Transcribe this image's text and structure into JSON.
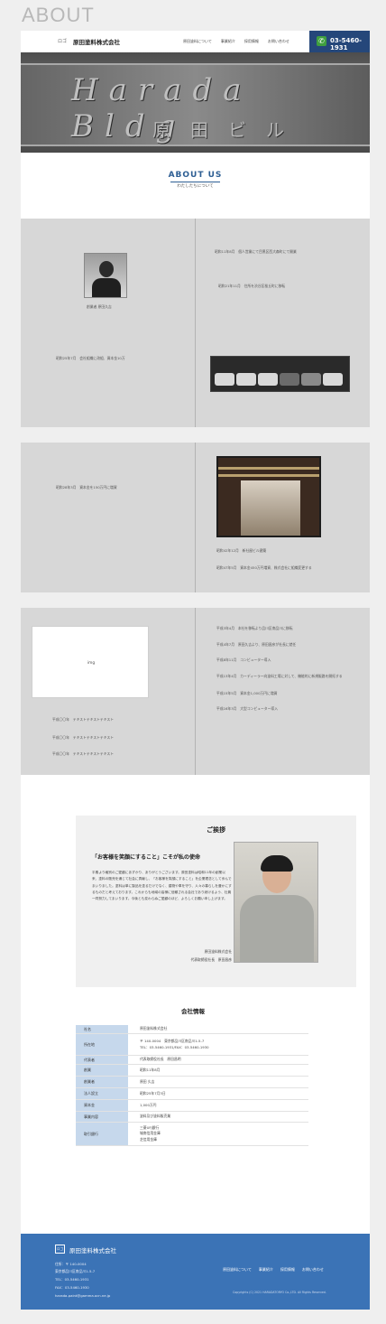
{
  "page_heading": "ABOUT",
  "header": {
    "logo": "ロゴ",
    "company": "原田塗料株式会社",
    "nav": [
      "原田塗料について",
      "事業紹介",
      "採用情報",
      "お問い合わせ"
    ],
    "phone": "03-5460-1931"
  },
  "about": {
    "title": "ABOUT US",
    "subtitle": "わたしたちについて"
  },
  "history": {
    "founder_caption": "創業者 原田久吉",
    "e1": "昭和11年8月　個人営業にて目黒区西大森町にて開業",
    "e2": "昭和21年11月　住所を渋谷区桜丘町に移転",
    "e3": "昭和25年7月　会社組織に改組、資本金10万",
    "e4": "昭和28年3月　資本金を150万円に増資",
    "e5": "昭和42年12月　新社屋ビル建築",
    "e6": "昭和47年5月　資本金450万円増資、株式会社に組織変更する",
    "e7": "平成3年4月　本社を移転より品川区南品川に移転",
    "e8": "平成4年7月　原田久吉より、原田昌彦が社長に就任",
    "e9": "平成8年11月　コンピューター導入",
    "e10": "平成13年4月　カーディーラー向塗料工場に対して、機能的に新規販路を開拓する",
    "e11": "平成15年5月　資本金1,000万円に増資",
    "e12": "平成16年3月　大型コンピューター導入",
    "img_label": "img",
    "p1": "平成〇〇年　テキストテキストテキスト",
    "p2": "平成〇〇年　テキストテキストテキスト",
    "p3": "平成〇〇年　テキストテキストテキスト"
  },
  "greeting": {
    "title": "ご挨拶",
    "mission": "「お客様を笑顔にすること」こそが私の使命",
    "body": "平素より格別のご愛顧にあずかり、ありがとうございます。原田塗料は昭和11年の創業以来、塗料の販売を通じて社会に貢献し、「お客様を笑顔にすること」を企業理念として歩んでまいりました。塗料は単に製品を塗るだけでなく、建物や車を守り、人々の暮らしを豊かにするものだと考えております。これからも地域の皆様に信頼される会社であり続けるよう、社員一同努力してまいります。今後とも変わらぬご愛顧のほど、よろしくお願い申し上げます。",
    "sign_company": "原田塗料株式会社",
    "sign_name": "代表取締役社長　原田昌彦"
  },
  "company_info": {
    "title": "会社情報",
    "rows": [
      {
        "label": "社名",
        "lines": [
          "原田塗料株式会社"
        ]
      },
      {
        "label": "所在地",
        "lines": [
          "〒 140-0004　東京都品川区南品川1-5-7",
          "TEL：03-5460-1931/FAX：03-5460-1930"
        ]
      },
      {
        "label": "代表者",
        "lines": [
          "代表取締役社長　原田昌明"
        ]
      },
      {
        "label": "創業",
        "lines": [
          "昭和11年8月"
        ]
      },
      {
        "label": "創業者",
        "lines": [
          "原田 久吉"
        ]
      },
      {
        "label": "法人設立",
        "lines": [
          "昭和25年7月3日"
        ]
      },
      {
        "label": "資本金",
        "lines": [
          "1,000万円"
        ]
      },
      {
        "label": "事業内容",
        "lines": [
          "塗料及び塗料販売業"
        ]
      },
      {
        "label": "取引銀行",
        "lines": [
          "三菱UFJ銀行",
          "城南信用金庫",
          "芝信用金庫"
        ]
      }
    ]
  },
  "footer": {
    "logo": "ロゴ",
    "company": "原田塗料株式会社",
    "address1": "住所：〒 140-0004",
    "address2": "東京都品川区南品川1-5-7",
    "tel": "TEL：03-5460-1931",
    "fax": "FAX：03-5460-1930",
    "email": "harada-paint@gamma.ocn.ne.jp",
    "nav": [
      "原田塗料について",
      "事業紹介",
      "採用情報",
      "お問い合わせ"
    ],
    "copyright": "Copyrights (C) 2021 HARADATORYO Co.,LTD. All Rights Reserved."
  }
}
